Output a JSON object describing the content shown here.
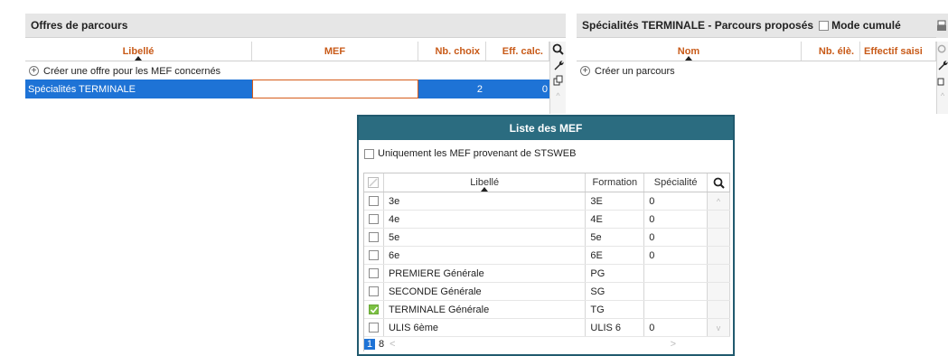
{
  "left_panel": {
    "title": "Offres de parcours",
    "columns": [
      "Libellé",
      "MEF",
      "Nb. choix",
      "Eff. calc."
    ],
    "create_label": "Créer une offre pour les MEF concernés",
    "selected_row": {
      "libelle": "Spécialités TERMINALE",
      "mef": "",
      "nb_choix": "2",
      "eff_calc": "0"
    }
  },
  "right_panel": {
    "title": "Spécialités TERMINALE - Parcours proposés",
    "mode_cumule_label": "Mode cumulé",
    "columns": [
      "Nom",
      "Nb. élè.",
      "Effectif saisi"
    ],
    "create_label": "Créer un parcours"
  },
  "dialog": {
    "title": "Liste des MEF",
    "filter_label": "Uniquement les MEF provenant de STSWEB",
    "columns": [
      "Libellé",
      "Formation",
      "Spécialité"
    ],
    "rows": [
      {
        "libelle": "3e",
        "formation": "3E",
        "specialite": "0",
        "checked": false
      },
      {
        "libelle": "4e",
        "formation": "4E",
        "specialite": "0",
        "checked": false
      },
      {
        "libelle": "5e",
        "formation": "5e",
        "specialite": "0",
        "checked": false
      },
      {
        "libelle": "6e",
        "formation": "6E",
        "specialite": "0",
        "checked": false
      },
      {
        "libelle": "PREMIERE Générale",
        "formation": "PG",
        "specialite": "",
        "checked": false
      },
      {
        "libelle": "SECONDE Générale",
        "formation": "SG",
        "specialite": "",
        "checked": false
      },
      {
        "libelle": "TERMINALE Générale",
        "formation": "TG",
        "specialite": "",
        "checked": true
      },
      {
        "libelle": "ULIS 6ème",
        "formation": "ULIS 6",
        "specialite": "0",
        "checked": false
      }
    ],
    "footer_selected": "1",
    "footer_total": "8"
  },
  "colors": {
    "header_orange": "#c85a18",
    "selection_blue": "#1e73d6",
    "dialog_teal": "#2b6c80",
    "check_green": "#7cc142"
  },
  "icons": [
    "search-icon",
    "wrench-icon",
    "duplicate-icon",
    "scroll-up-arrow-icon",
    "scroll-down-arrow-icon",
    "print-icon"
  ]
}
